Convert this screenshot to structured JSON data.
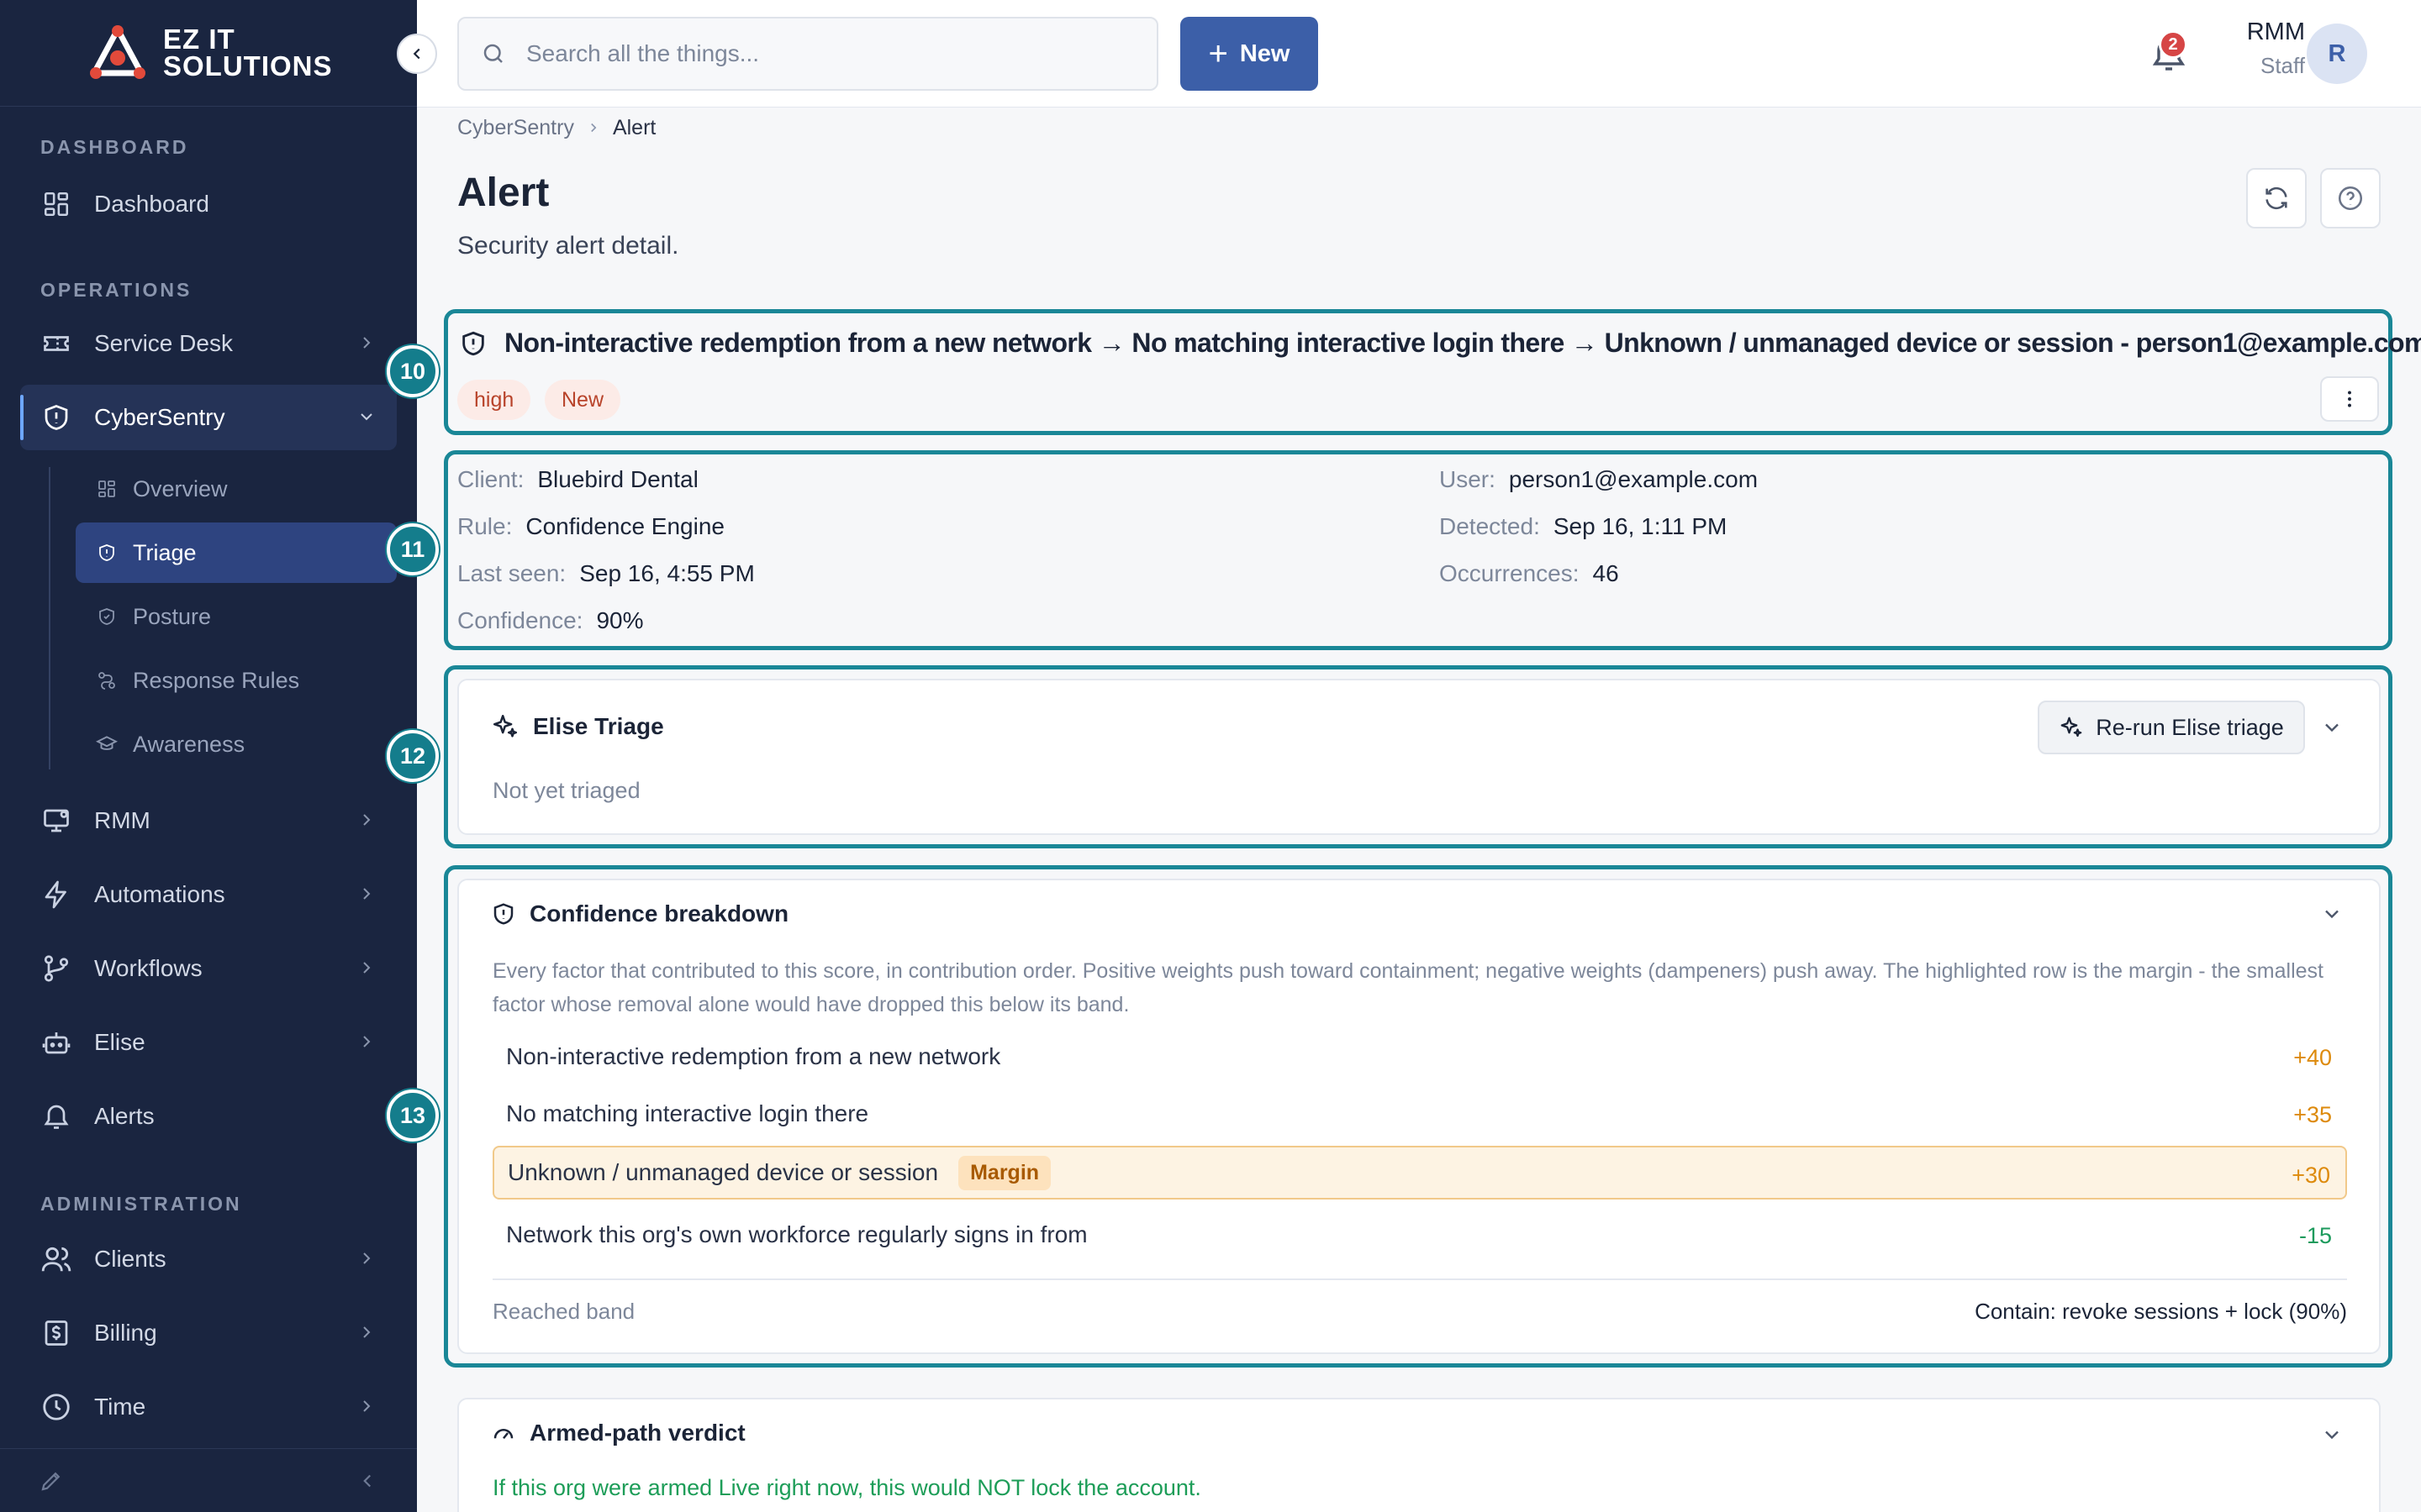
{
  "brand": {
    "line1": "EZ IT",
    "line2": "SOLUTIONS"
  },
  "sidebar": {
    "sections": {
      "dashboard": "DASHBOARD",
      "operations": "OPERATIONS",
      "administration": "ADMINISTRATION"
    },
    "items": {
      "dashboard": "Dashboard",
      "service_desk": "Service Desk",
      "cybersentry": "CyberSentry",
      "rmm": "RMM",
      "automations": "Automations",
      "workflows": "Workflows",
      "elise": "Elise",
      "alerts": "Alerts",
      "clients": "Clients",
      "billing": "Billing",
      "time": "Time"
    },
    "sub_items": {
      "overview": "Overview",
      "triage": "Triage",
      "posture": "Posture",
      "response_rules": "Response Rules",
      "awareness": "Awareness"
    },
    "active_item": "CyberSentry",
    "active_sub_item": "Triage"
  },
  "markers": {
    "m10": "10",
    "m11": "11",
    "m12": "12",
    "m13": "13"
  },
  "topbar": {
    "search_placeholder": "Search all the things...",
    "new_label": "New",
    "notification_count": "2",
    "user_name": "RMM",
    "user_role": "Staff",
    "avatar_initial": "R"
  },
  "breadcrumb": {
    "parent": "CyberSentry",
    "current": "Alert"
  },
  "page": {
    "title": "Alert",
    "subtitle": "Security alert detail."
  },
  "alert": {
    "title": "Non-interactive redemption from a new network → No matching interactive login there → Unknown / unmanaged device or session - person1@example.com",
    "severity": "high",
    "status": "New"
  },
  "details": {
    "client_label": "Client:",
    "client": "Bluebird Dental",
    "user_label": "User:",
    "user": "person1@example.com",
    "rule_label": "Rule:",
    "rule": "Confidence Engine",
    "detected_label": "Detected:",
    "detected": "Sep 16, 1:11 PM",
    "last_seen_label": "Last seen:",
    "last_seen": "Sep 16, 4:55 PM",
    "occurrences_label": "Occurrences:",
    "occurrences": "46",
    "confidence_label": "Confidence:",
    "confidence": "90%"
  },
  "triage": {
    "title": "Elise Triage",
    "rerun_label": "Re-run Elise triage",
    "status": "Not yet triaged"
  },
  "breakdown": {
    "title": "Confidence breakdown",
    "description": "Every factor that contributed to this score, in contribution order. Positive weights push toward containment; negative weights (dampeners) push away. The highlighted row is the margin - the smallest factor whose removal alone would have dropped this below its band.",
    "factors": [
      {
        "label": "Non-interactive redemption from a new network",
        "weight": "+40"
      },
      {
        "label": "No matching interactive login there",
        "weight": "+35"
      },
      {
        "label": "Unknown / unmanaged device or session",
        "weight": "+30",
        "tag": "Margin"
      },
      {
        "label": "Network this org's own workforce regularly signs in from",
        "weight": "-15"
      }
    ],
    "band_label": "Reached band",
    "band_value": "Contain: revoke sessions + lock (90%)"
  },
  "verdict": {
    "title": "Armed-path verdict",
    "text": "If this org were armed Live right now, this would NOT lock the account."
  },
  "colors": {
    "sidebar_bg": "#1a2540",
    "accent": "#3c5fa8",
    "highlight_border": "#1a8797",
    "severity": "#b8432a",
    "positive_weight": "#dd8a0c",
    "negative_weight": "#1c9a5c",
    "verdict": "#1d9d58"
  }
}
